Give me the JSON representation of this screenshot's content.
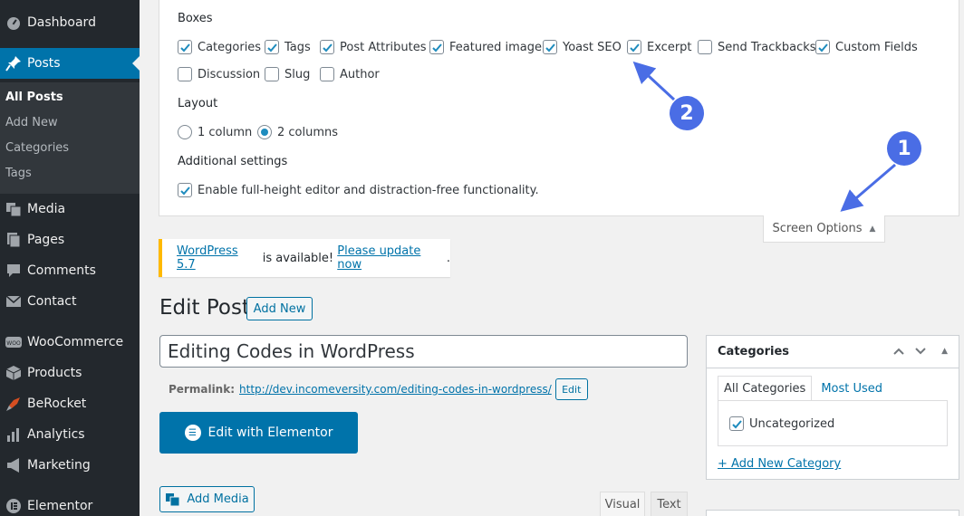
{
  "sidebar": {
    "items": [
      {
        "label": "Dashboard",
        "icon": "dashboard-icon"
      },
      {
        "label": "Posts",
        "icon": "pin-icon"
      },
      {
        "label": "Media",
        "icon": "media-icon"
      },
      {
        "label": "Pages",
        "icon": "pages-icon"
      },
      {
        "label": "Comments",
        "icon": "comments-icon"
      },
      {
        "label": "Contact",
        "icon": "mail-icon"
      },
      {
        "label": "WooCommerce",
        "icon": "woocommerce-icon"
      },
      {
        "label": "Products",
        "icon": "box-icon"
      },
      {
        "label": "BeRocket",
        "icon": "rocket-icon"
      },
      {
        "label": "Analytics",
        "icon": "bar-chart-icon"
      },
      {
        "label": "Marketing",
        "icon": "megaphone-icon"
      },
      {
        "label": "Elementor",
        "icon": "elementor-icon"
      }
    ],
    "posts_submenu": [
      "All Posts",
      "Add New",
      "Categories",
      "Tags"
    ]
  },
  "screen_options": {
    "boxes_heading": "Boxes",
    "boxes": [
      {
        "label": "Categories",
        "checked": true
      },
      {
        "label": "Tags",
        "checked": true
      },
      {
        "label": "Post Attributes",
        "checked": true
      },
      {
        "label": "Featured image",
        "checked": true
      },
      {
        "label": "Yoast SEO",
        "checked": true
      },
      {
        "label": "Excerpt",
        "checked": true
      },
      {
        "label": "Send Trackbacks",
        "checked": false
      },
      {
        "label": "Custom Fields",
        "checked": true
      },
      {
        "label": "Discussion",
        "checked": false
      },
      {
        "label": "Slug",
        "checked": false
      },
      {
        "label": "Author",
        "checked": false
      }
    ],
    "layout_heading": "Layout",
    "layout_options": [
      {
        "label": "1 column",
        "selected": false
      },
      {
        "label": "2 columns",
        "selected": true
      }
    ],
    "additional_heading": "Additional settings",
    "additional_option": {
      "label": "Enable full-height editor and distraction-free functionality.",
      "checked": true
    },
    "tab_label": "Screen Options"
  },
  "notice": {
    "link1": "WordPress 5.7",
    "text": " is available! ",
    "link2": "Please update now",
    "end": "."
  },
  "editor": {
    "page_title": "Edit Post",
    "add_new": "Add New",
    "post_title": "Editing Codes in WordPress",
    "permalink_label": "Permalink:",
    "permalink_base": "http://dev.incomeversity.com/",
    "permalink_slug": "editing-codes-in-wordpress",
    "permalink_end": "/",
    "permalink_edit": "Edit",
    "elementor_button": "Edit with Elementor",
    "add_media": "Add Media",
    "tab_visual": "Visual",
    "tab_text": "Text"
  },
  "categories_box": {
    "title": "Categories",
    "tab_all": "All Categories",
    "tab_most_used": "Most Used",
    "items": [
      {
        "label": "Uncategorized",
        "checked": true
      }
    ],
    "add_new": "+ Add New Category"
  },
  "annotations": [
    "1",
    "2"
  ],
  "colors": {
    "sidebar_bg": "#23282d",
    "active_menu": "#0073aa",
    "badge": "#4a6de5",
    "notice_border": "#ffb900"
  }
}
